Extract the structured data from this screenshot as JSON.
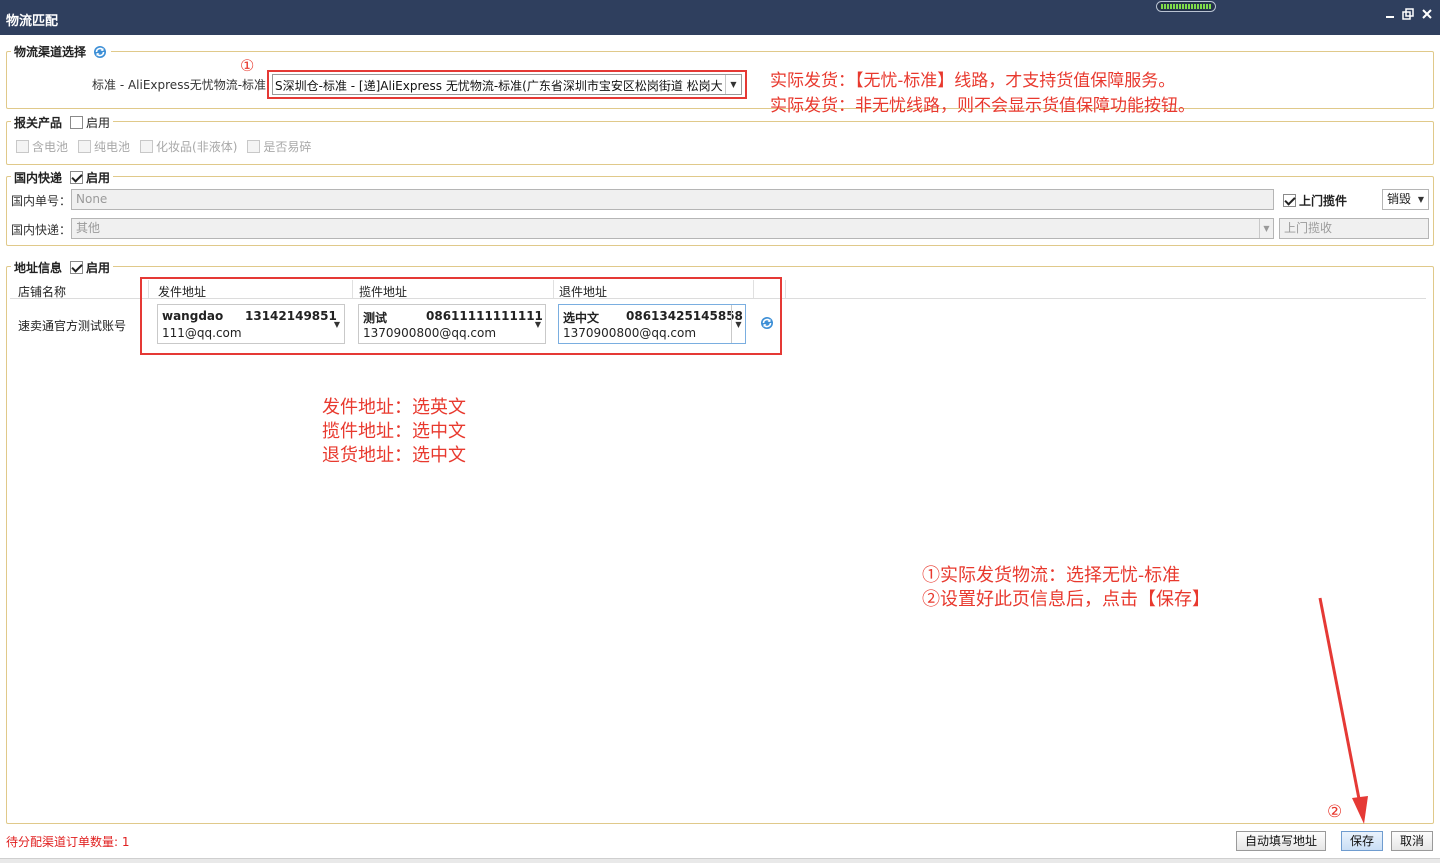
{
  "window": {
    "title": "物流匹配",
    "minimize_glyph": "✕",
    "restore_glyph": "❐",
    "close_glyph": "✕"
  },
  "channel": {
    "legend": "物流渠道选择",
    "label": "标准 - AliExpress无忧物流-标准:",
    "selected": "S深圳仓-标准 - [递]AliExpress 无忧物流-标准(广东省深圳市宝安区松岗街道 松岗大",
    "marker": "①",
    "note1": "实际发货：【无忧-标准】线路，才支持货值保障服务。",
    "note2": "实际发货：非无忧线路，则不会显示货值保障功能按钮。"
  },
  "customs": {
    "legend": "报关产品",
    "enable_label": "启用",
    "options": [
      "含电池",
      "纯电池",
      "化妆品(非液体)",
      "是否易碎"
    ]
  },
  "domestic": {
    "legend": "国内快递",
    "enable_label": "启用",
    "number_label": "国内单号：",
    "number_placeholder": "None",
    "pickup_label": "上门揽件",
    "pickup_select": "销毁",
    "express_label": "国内快递：",
    "express_value": "其他",
    "pickup_receive": "上门揽收"
  },
  "address": {
    "legend": "地址信息",
    "enable_label": "启用",
    "headers": {
      "store": "店铺名称",
      "sender": "发件地址",
      "pickup": "揽件地址",
      "return": "退件地址"
    },
    "store_name": "速卖通官方测试账号",
    "sender": {
      "name": "wangdao",
      "phone": "13142149851",
      "email": "111@qq.com"
    },
    "pickup": {
      "name": "测试",
      "phone": "08611111111111",
      "email": "1370900800@qq.com"
    },
    "return": {
      "name": "选中文",
      "phone": "08613425145858",
      "email": "1370900800@qq.com"
    },
    "notes": [
      "发件地址：选英文",
      "揽件地址：选中文",
      "退货地址：选中文"
    ]
  },
  "instructions": [
    "①实际发货物流：选择无忧-标准",
    "②设置好此页信息后，点击【保存】"
  ],
  "save_marker": "②",
  "footer": {
    "pending_count": "待分配渠道订单数量: 1",
    "auto_fill": "自动填写地址",
    "save": "保存",
    "cancel": "取消"
  },
  "colors": {
    "titlebar": "#2f3f5e",
    "annotation": "#e8392e",
    "group_border": "#e0c98a"
  },
  "icons": [
    "refresh-icon",
    "checkbox-checked-icon",
    "chevron-down-icon",
    "close-icon",
    "restore-icon"
  ]
}
